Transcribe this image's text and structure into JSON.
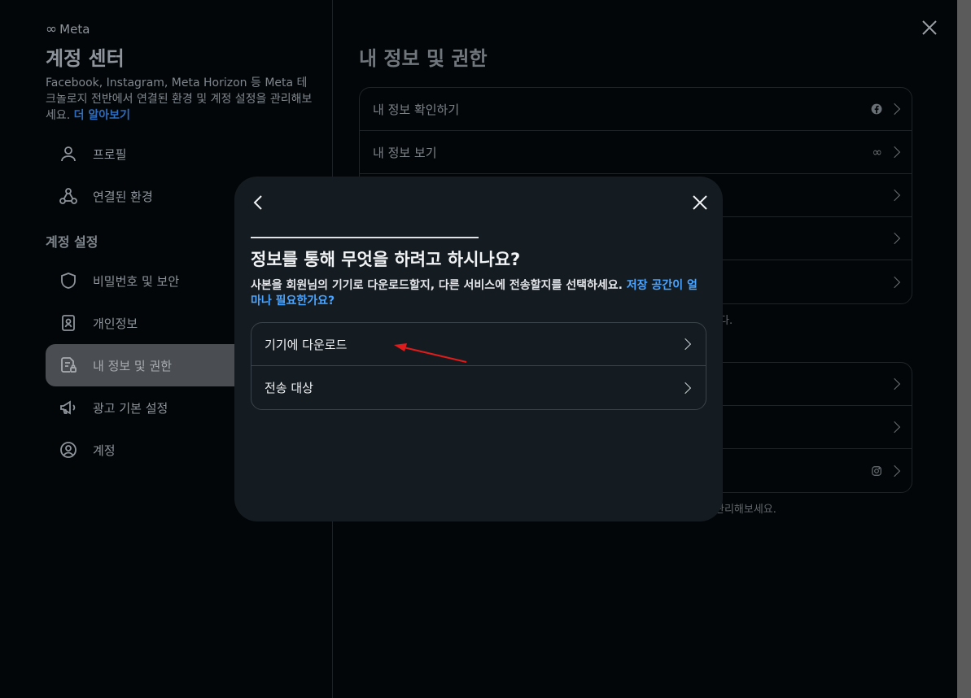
{
  "sidebar": {
    "brand": "Meta",
    "title": "계정 센터",
    "description": "Facebook, Instagram, Meta Horizon 등 Meta 테크놀로지 전반에서 연결된 환경 및 계정 설정을 관리해보세요.",
    "learn_more": "더 알아보기",
    "items_top": [
      {
        "label": "프로필",
        "icon": "user-icon"
      },
      {
        "label": "연결된 환경",
        "icon": "connected-icon"
      }
    ],
    "section_label": "계정 설정",
    "items_settings": [
      {
        "label": "비밀번호 및 보안",
        "icon": "shield-icon"
      },
      {
        "label": "개인정보",
        "icon": "id-card-icon"
      },
      {
        "label": "내 정보 및 권한",
        "icon": "document-lock-icon",
        "active": true
      },
      {
        "label": "광고 기본 설정",
        "icon": "megaphone-icon"
      },
      {
        "label": "계정",
        "icon": "account-circle-icon"
      }
    ]
  },
  "main": {
    "title": "내 정보 및 권한",
    "card1": [
      {
        "label": "내 정보 확인하기",
        "badge_icon": "facebook-icon"
      },
      {
        "label": "내 정보 보기",
        "badge_icon": "meta-icon"
      },
      {
        "label": ""
      },
      {
        "label": ""
      },
      {
        "label": ""
      }
    ],
    "note1": "다.",
    "card2": [
      {
        "label": ""
      },
      {
        "label": ""
      },
      {
        "label": "",
        "badge_icon": "instagram-icon"
      }
    ],
    "note2": "관리해보세요."
  },
  "modal": {
    "title": "정보를 통해 무엇을 하려고 하시나요?",
    "subtitle": "사본을 회원님의 기기로 다운로드할지, 다른 서비스에 전송할지를 선택하세요.",
    "subtitle_link": "저장 공간이 얼마나 필요한가요?",
    "options": [
      {
        "label": "기기에 다운로드"
      },
      {
        "label": "전송 대상"
      }
    ]
  },
  "colors": {
    "accent": "#4aa4ff",
    "annotation_arrow": "#e01b1b"
  }
}
